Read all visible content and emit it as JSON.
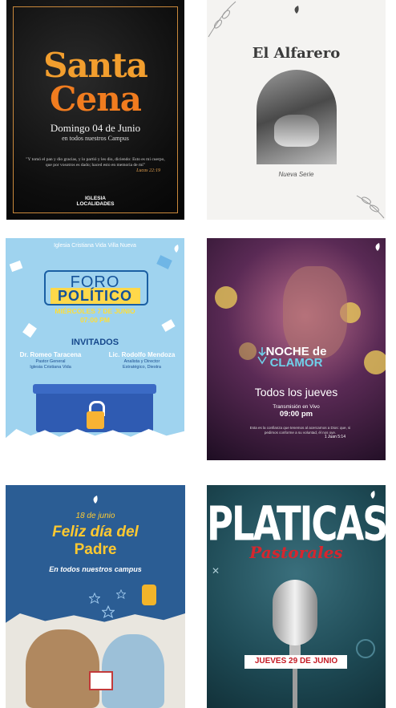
{
  "cards": [
    {
      "title_line1": "Santa",
      "title_line2": "Cena",
      "date": "Domingo 04 de Junio",
      "campus": "en todos nuestros Campus",
      "verse": "\"Y tomó el pan y dio gracias, y lo partió y les dio, diciendo: Esto es mi cuerpo, que por vosotros es dado; haced esto en memoria de mí\"",
      "reference": "Lucas 22:19",
      "logo_line1": "IGLESIA",
      "logo_line2": "LOCALIDADES"
    },
    {
      "title": "El Alfarero",
      "subtitle": "Nueva Serie"
    },
    {
      "church": "Iglesia Cristiana Vida Villa Nueva",
      "title_line1": "FORO",
      "title_line2": "POLÍTICO",
      "date": "MIÉRCOLES 7 DE JUNIO",
      "time": "07:00 PM",
      "guests_heading": "INVITADOS",
      "guests": [
        {
          "name": "Dr. Romeo Taracena",
          "role1": "Pastor General",
          "role2": "Iglesia Cristiana Vida"
        },
        {
          "name": "Lic. Rodolfo Mendoza",
          "role1": "Analista y Director",
          "role2": "Estratégico, Diestra"
        }
      ]
    },
    {
      "title_line1": "NOCHE de",
      "title_line2": "CLAMOR",
      "schedule": "Todos los jueves",
      "broadcast": "Transmisión en Vivo",
      "time": "09:00 pm",
      "verse": "Esta es la confianza que tenemos al acercarnos a Dios: que, si pedimos conforme a su voluntad, él nos oye.",
      "reference": "1 Juan 5:14"
    },
    {
      "date": "18 de junio",
      "title_line1": "Feliz día del",
      "title_line2": "Padre",
      "campus": "En todos nuestros campus"
    },
    {
      "title": "PLATICAS",
      "subtitle": "Pastorales",
      "date": "JUEVES 29 DE JUNIO"
    }
  ]
}
